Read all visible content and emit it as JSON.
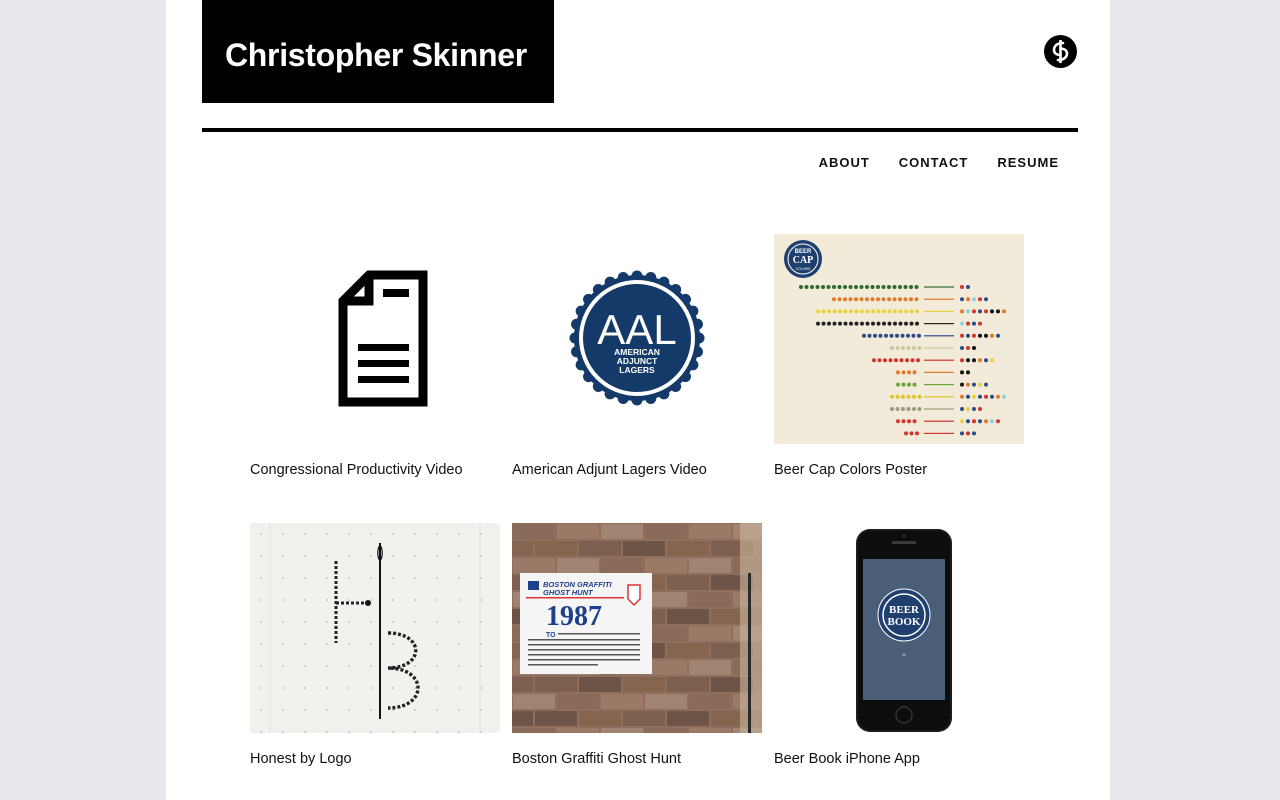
{
  "site": {
    "name": "Christopher Skinner"
  },
  "nav": {
    "items": [
      {
        "label": "ABOUT"
      },
      {
        "label": "CONTACT"
      },
      {
        "label": "RESUME"
      }
    ]
  },
  "portfolio": {
    "items": [
      {
        "title": "Congressional Productivity Video",
        "thumb": "document-icon"
      },
      {
        "title": "American Adjunt Lagers Video",
        "thumb": "aal-badge",
        "badge": {
          "abbr": "AAL",
          "line1": "AMERICAN",
          "line2": "ADJUNCT",
          "line3": "LAGERS",
          "color": "#133a68"
        }
      },
      {
        "title": "Beer Cap Colors Poster",
        "thumb": "beer-cap-poster",
        "badge": {
          "line1": "BEER",
          "line2": "CAP",
          "line3": "COLORS"
        }
      },
      {
        "title": "Honest by Logo",
        "thumb": "needle-hb-photo"
      },
      {
        "title": "Boston Graffiti Ghost Hunt",
        "thumb": "brick-wall-sign-photo",
        "sign": {
          "title_line1": "BOSTON GRAFFITI",
          "title_line2": "GHOST HUNT",
          "year": "1987",
          "to": "TO"
        }
      },
      {
        "title": "Beer Book iPhone App",
        "thumb": "iphone-app",
        "badge": {
          "line1": "BEER",
          "line2": "BOOK"
        }
      }
    ]
  },
  "colors": {
    "page_bg": "#e7e8ec",
    "content_bg": "#ffffff",
    "brand_black": "#000000",
    "aal_blue": "#133a68"
  }
}
